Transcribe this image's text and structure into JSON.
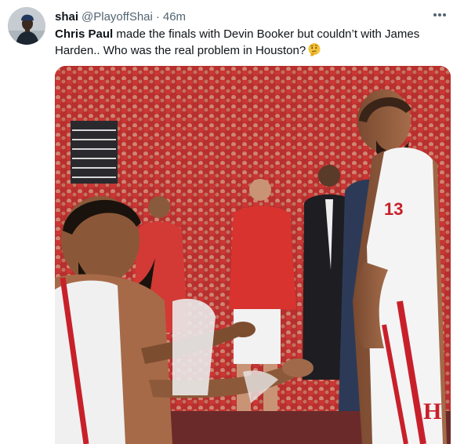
{
  "tweet": {
    "display_name": "shai",
    "handle": "@PlayoffShai",
    "separator": "·",
    "time": "46m",
    "text_bold": "Chris Paul",
    "text_rest": " made the finals with Devin Booker but couldn’t with James Harden..  Who was the real problem in Houston?",
    "emoji": "thinking-face-emoji",
    "more_icon": "more-horizontal-icon"
  },
  "media": {
    "kind": "photo",
    "jersey_number": "13",
    "logo_text": "H"
  },
  "colors": {
    "text_primary": "#0f1419",
    "text_secondary": "#536471",
    "crowd_red": "#c8302f",
    "emoji_yellow": "#f5c33b"
  }
}
